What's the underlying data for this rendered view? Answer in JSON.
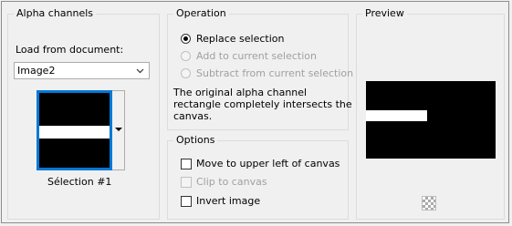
{
  "alpha": {
    "title": "Alpha channels",
    "load_label": "Load from document:",
    "document_value": "Image2",
    "channel_name": "Sélection #1"
  },
  "operation": {
    "title": "Operation",
    "options": [
      {
        "label": "Replace selection",
        "selected": true,
        "enabled": true
      },
      {
        "label": "Add to current selection",
        "selected": false,
        "enabled": false
      },
      {
        "label": "Subtract from current selection",
        "selected": false,
        "enabled": false
      }
    ],
    "description_lines": [
      "The original alpha channel",
      "rectangle completely intersects the",
      "canvas."
    ]
  },
  "options": {
    "title": "Options",
    "items": [
      {
        "label": "Move to upper left of canvas",
        "checked": false,
        "enabled": true
      },
      {
        "label": "Clip to canvas",
        "checked": false,
        "enabled": false
      },
      {
        "label": "Invert image",
        "checked": false,
        "enabled": true
      }
    ]
  },
  "preview": {
    "title": "Preview"
  },
  "colors": {
    "accent": "#0078d7",
    "background": "#f0f0f0",
    "disabled_text": "#a0a0a0"
  },
  "icons": [
    "chevron-down-icon",
    "dropdown-arrow-icon",
    "zoom-preview-icon"
  ]
}
